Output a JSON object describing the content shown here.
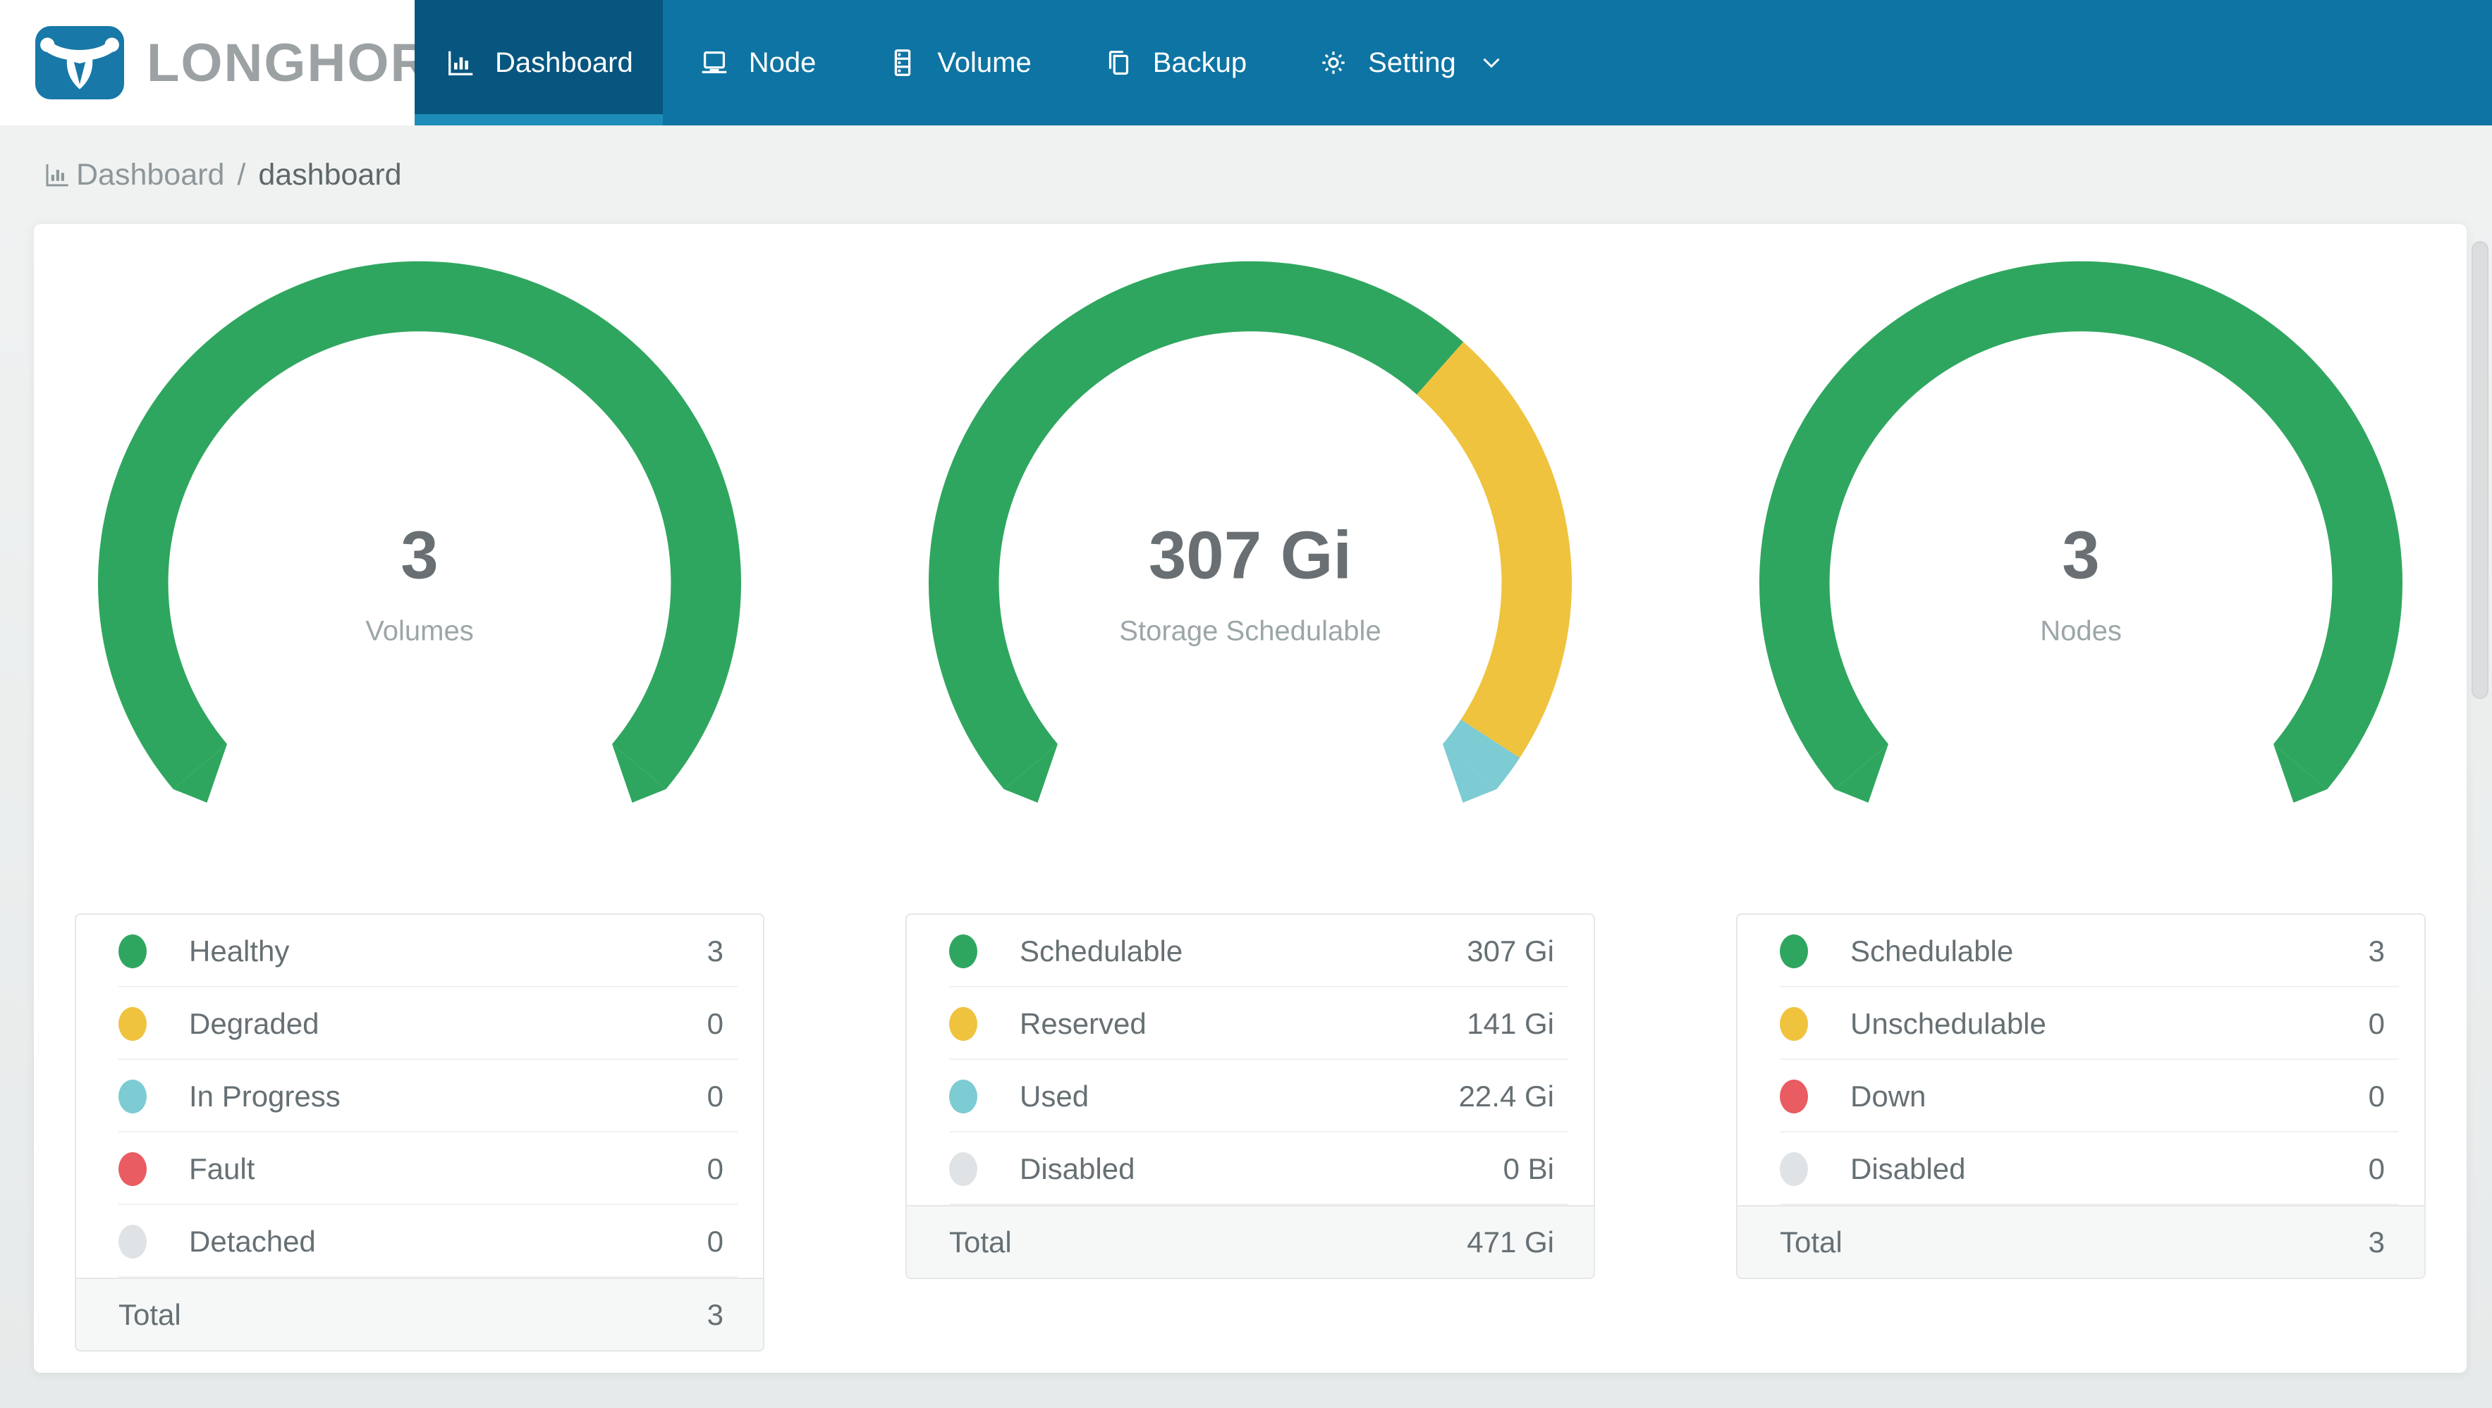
{
  "brand": {
    "name": "LONGHORN"
  },
  "colors": {
    "navbar": "#0E74A3",
    "navbar_active": "#07567F",
    "navbar_active_underline": "#1E8CB9",
    "logo_badge": "#1878A8",
    "green": "#2FA65F",
    "yellow": "#EFC33E",
    "teal": "#7DCBD3",
    "red": "#E85C62",
    "gray": "#E0E3E5"
  },
  "nav": {
    "items": [
      {
        "label": "Dashboard",
        "icon": "bar-chart-icon",
        "active": true
      },
      {
        "label": "Node",
        "icon": "laptop-icon",
        "active": false
      },
      {
        "label": "Volume",
        "icon": "server-stack-icon",
        "active": false
      },
      {
        "label": "Backup",
        "icon": "copy-pages-icon",
        "active": false
      },
      {
        "label": "Setting",
        "icon": "gear-icon",
        "active": false,
        "has_dropdown": true
      }
    ]
  },
  "breadcrumb": {
    "section": "Dashboard",
    "separator": "/",
    "page": "dashboard"
  },
  "gauges": [
    {
      "name": "volumes",
      "center_value": "3",
      "center_label": "Volumes",
      "rows": [
        {
          "label": "Healthy",
          "value": "3",
          "num": 3,
          "color": "#2FA65F"
        },
        {
          "label": "Degraded",
          "value": "0",
          "num": 0,
          "color": "#EFC33E"
        },
        {
          "label": "In Progress",
          "value": "0",
          "num": 0,
          "color": "#7DCBD3"
        },
        {
          "label": "Fault",
          "value": "0",
          "num": 0,
          "color": "#E85C62"
        },
        {
          "label": "Detached",
          "value": "0",
          "num": 0,
          "color": "#E0E3E5"
        }
      ],
      "total_label": "Total",
      "total_value": "3"
    },
    {
      "name": "storage-schedulable",
      "center_value": "307 Gi",
      "center_label": "Storage Schedulable",
      "rows": [
        {
          "label": "Schedulable",
          "value": "307 Gi",
          "num": 307,
          "color": "#2FA65F"
        },
        {
          "label": "Reserved",
          "value": "141 Gi",
          "num": 141,
          "color": "#EFC33E"
        },
        {
          "label": "Used",
          "value": "22.4 Gi",
          "num": 22.4,
          "color": "#7DCBD3"
        },
        {
          "label": "Disabled",
          "value": "0 Bi",
          "num": 0,
          "color": "#E0E3E5"
        }
      ],
      "total_label": "Total",
      "total_value": "471 Gi"
    },
    {
      "name": "nodes",
      "center_value": "3",
      "center_label": "Nodes",
      "rows": [
        {
          "label": "Schedulable",
          "value": "3",
          "num": 3,
          "color": "#2FA65F"
        },
        {
          "label": "Unschedulable",
          "value": "0",
          "num": 0,
          "color": "#EFC33E"
        },
        {
          "label": "Down",
          "value": "0",
          "num": 0,
          "color": "#E85C62"
        },
        {
          "label": "Disabled",
          "value": "0",
          "num": 0,
          "color": "#E0E3E5"
        }
      ],
      "total_label": "Total",
      "total_value": "3"
    }
  ]
}
